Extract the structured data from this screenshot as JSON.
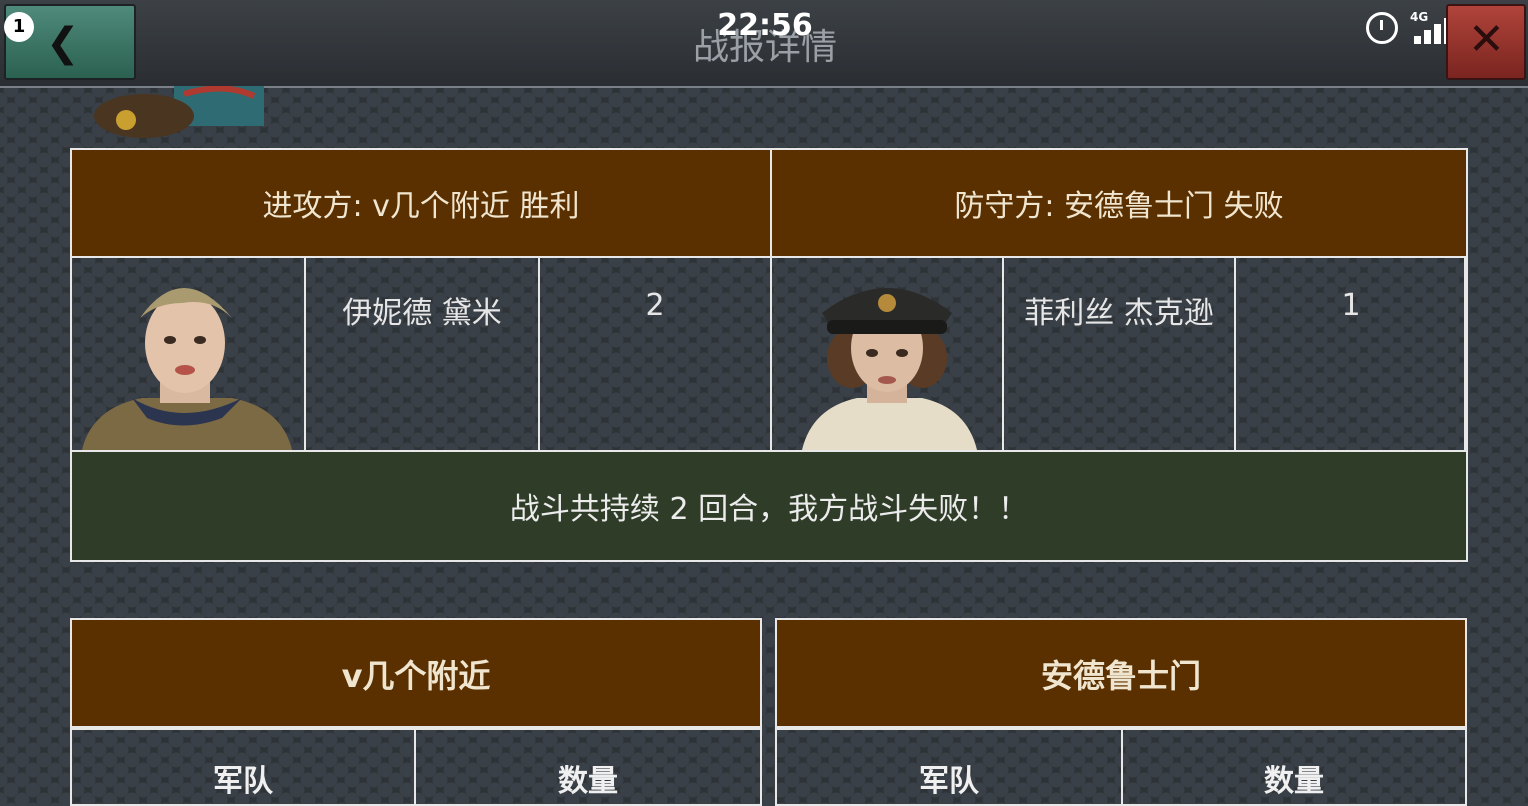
{
  "status_bar": {
    "time": "22:56",
    "notification_count": "1",
    "network": "4G",
    "battery": "37",
    "icons": [
      "alarm-icon",
      "signal-icon",
      "battery-icon"
    ]
  },
  "header": {
    "title": "战报详情",
    "back_icon": "chevron-left-icon",
    "close_icon": "close-icon"
  },
  "summary": {
    "attacker_label": "进攻方:  v几个附近    胜利",
    "defender_label": "防守方:  安德鲁士门    失败",
    "attacker_commander": {
      "name": "伊妮德 黛米",
      "count": "2"
    },
    "defender_commander": {
      "name": "菲利丝 杰克逊",
      "count": "1"
    },
    "result_text": "战斗共持续 2 回合，我方战斗失败！！"
  },
  "forces": [
    {
      "team": "v几个附近",
      "col_troops": "军队",
      "col_count": "数量"
    },
    {
      "team": "安德鲁士门",
      "col_troops": "军队",
      "col_count": "数量"
    }
  ],
  "colors": {
    "header_brown": "#5a3000",
    "result_green": "#2f3c28",
    "border": "#e8e8e8"
  }
}
